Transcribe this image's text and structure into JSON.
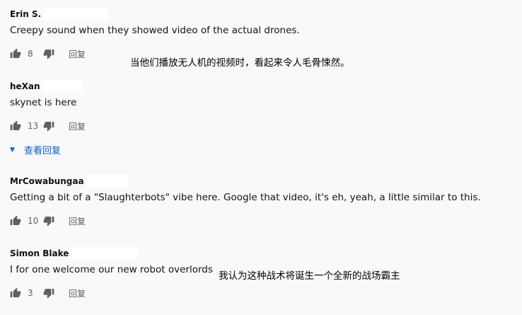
{
  "comments": [
    {
      "author": "Erin S.",
      "text": "Creepy sound when they showed video of the actual drones.",
      "likes": "8",
      "reply_label": "回复"
    },
    {
      "author": "heXan",
      "text": "skynet is here",
      "likes": "13",
      "reply_label": "回复"
    },
    {
      "author": "MrCowabungaa",
      "text": "Getting a bit of a \"Slaughterbots\" vibe here. Google that video, it's eh, yeah, a little similar to this.",
      "likes": "10",
      "reply_label": "回复"
    },
    {
      "author": "Simon Blake",
      "text": "I for one welcome our new robot overlords",
      "likes": "3",
      "reply_label": "回复"
    }
  ],
  "view_replies_label": "查看回复",
  "annotations": {
    "first": "当他们播放无人机的视频时，看起来令人毛骨悚然。",
    "second": "我认为这种战术将诞生一个全新的战场霸主"
  },
  "colors": {
    "background": "#f9f9f9",
    "link": "#065fd4",
    "muted": "#606060"
  }
}
